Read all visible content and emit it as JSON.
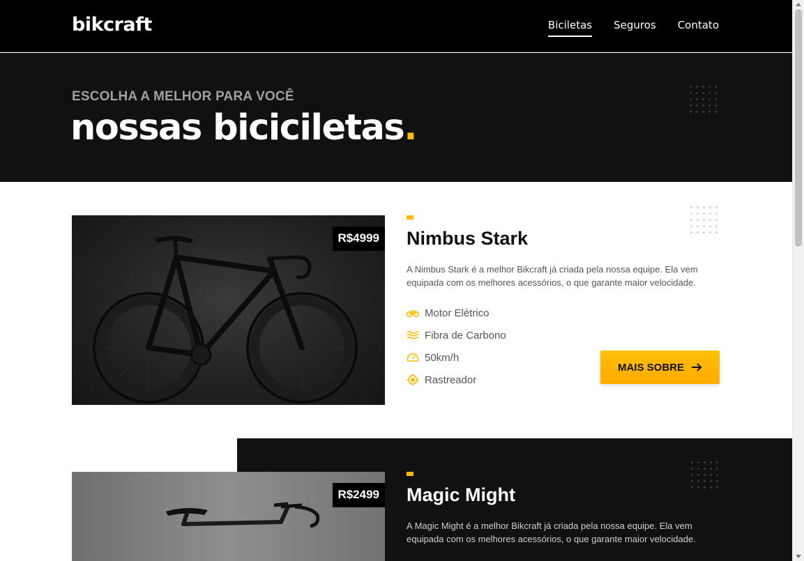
{
  "header": {
    "logo": "bikcraft",
    "nav": [
      {
        "label": "Biciletas",
        "active": true
      },
      {
        "label": "Seguros",
        "active": false
      },
      {
        "label": "Contato",
        "active": false
      }
    ]
  },
  "hero": {
    "subtitle": "ESCOLHA A MELHOR PARA VOCÊ",
    "title": "nossas biciciletas",
    "title_dot": "."
  },
  "products": [
    {
      "price": "R$4999",
      "name": "Nimbus Stark",
      "description": "A Nimbus Stark é a melhor Bikcraft já criada pela nossa equipe. Ela vem equipada com os melhores acessórios, o que garante maior velocidade.",
      "features": [
        {
          "icon": "electric-motor-icon",
          "label": "Motor Elétrico"
        },
        {
          "icon": "carbon-fiber-icon",
          "label": "Fibra de Carbono"
        },
        {
          "icon": "speedometer-icon",
          "label": "50km/h"
        },
        {
          "icon": "tracker-icon",
          "label": "Rastreador"
        }
      ],
      "button_label": "MAIS SOBRE",
      "button_icon": "arrow-right-icon"
    },
    {
      "price": "R$2499",
      "name": "Magic Might",
      "description": "A Magic Might é a melhor Bikcraft já criada pela nossa equipe. Ela vem equipada com os melhores acessórios, o que garante maior velocidade."
    }
  ],
  "colors": {
    "accent": "#ffbb00",
    "dark": "#111111",
    "black": "#000000"
  }
}
